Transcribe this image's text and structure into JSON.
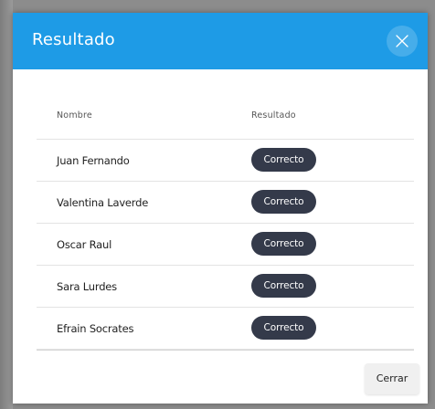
{
  "modal": {
    "title": "Resultado",
    "close_icon": "close-icon",
    "footer": {
      "close_label": "Cerrar"
    }
  },
  "table": {
    "columns": [
      "Nombre",
      "Resultado"
    ],
    "rows": [
      {
        "name": "Juan Fernando",
        "result": "Correcto"
      },
      {
        "name": "Valentina Laverde",
        "result": "Correcto"
      },
      {
        "name": "Oscar Raul",
        "result": "Correcto"
      },
      {
        "name": "Sara Lurdes",
        "result": "Correcto"
      },
      {
        "name": "Efrain Socrates",
        "result": "Correcto"
      }
    ]
  },
  "colors": {
    "header": "#1e9be6",
    "badge": "#343a4a",
    "backdrop": "#8c8c8c"
  }
}
